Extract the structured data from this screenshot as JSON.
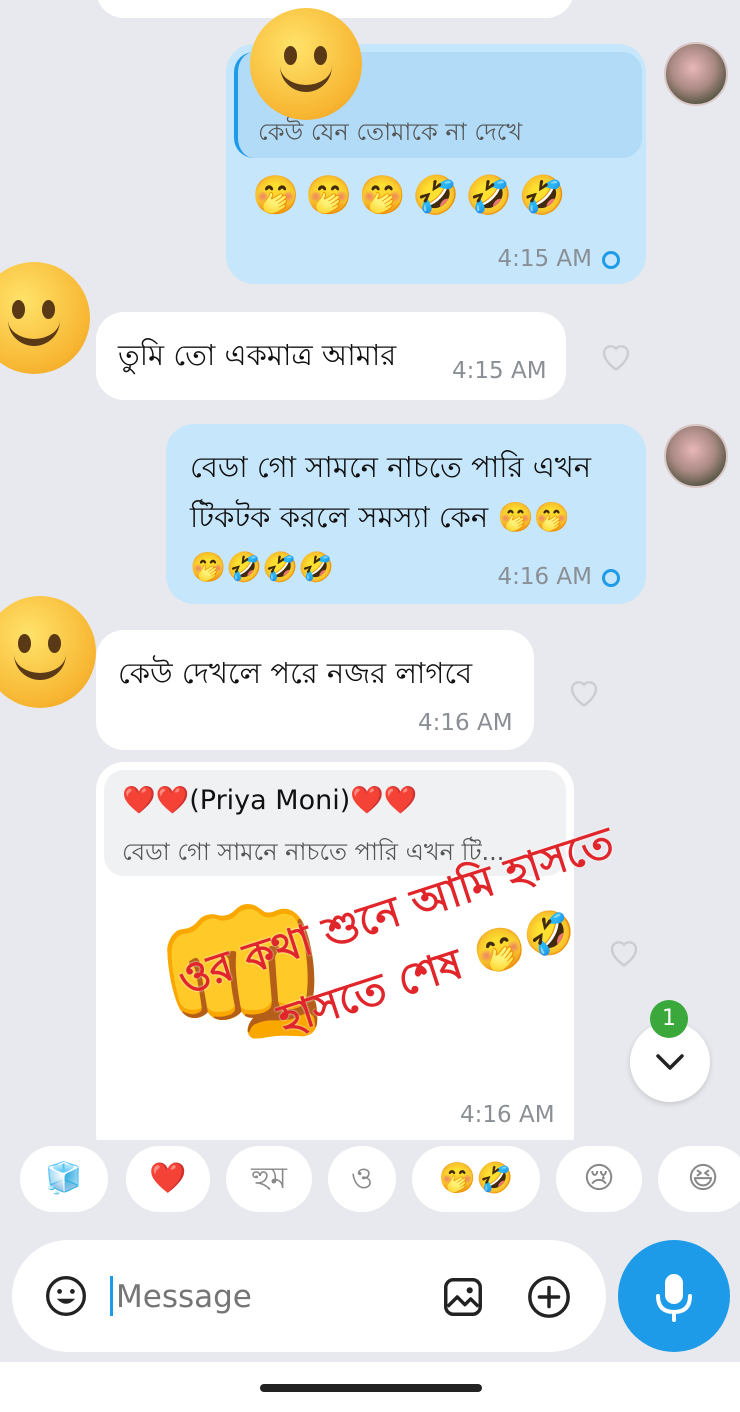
{
  "messages": [
    {
      "id": "m1",
      "direction": "outgoing",
      "reply_text": "কেউ যেন তোমাকে না দেখে",
      "emojis": "🤭🤭🤭🤣🤣🤣",
      "time": "4:15 AM"
    },
    {
      "id": "m2",
      "direction": "incoming",
      "text": "তুমি তো একমাত্র আমার",
      "time": "4:15 AM"
    },
    {
      "id": "m3",
      "direction": "outgoing",
      "line1": "বেডা গো সামনে নাচতে পারি এখন",
      "line2": "টিকটক করলে সমস্যা কেন 🤭🤭",
      "line3": "🤭🤣🤣🤣",
      "time": "4:16 AM"
    },
    {
      "id": "m4",
      "direction": "incoming",
      "text": "কেউ দেখলে পরে নজর লাগবে",
      "time": "4:16 AM"
    },
    {
      "id": "m5",
      "direction": "incoming",
      "reply_name": "❤️❤️(Priya Moni)❤️❤️",
      "reply_text": "বেডা গো সামনে নাচতে পারি এখন টি...",
      "sticker_line1": "ওর কথা শুনে আমি হাসতে",
      "sticker_line2": "হাসতে শেষ 🤭🤣",
      "fist": "👊",
      "time": "4:16 AM"
    }
  ],
  "scroll_badge": "1",
  "quick_replies": [
    "🧊",
    "❤️",
    "হুম",
    "ও",
    "🤭🤣",
    "😢",
    "😆"
  ],
  "composer": {
    "placeholder": "Message"
  },
  "colors": {
    "outgoing_bubble": "#c6e6fb",
    "incoming_bubble": "#ffffff",
    "accent": "#1e9be8",
    "background": "#e7e9ee",
    "sticker_text": "#e0262a"
  }
}
